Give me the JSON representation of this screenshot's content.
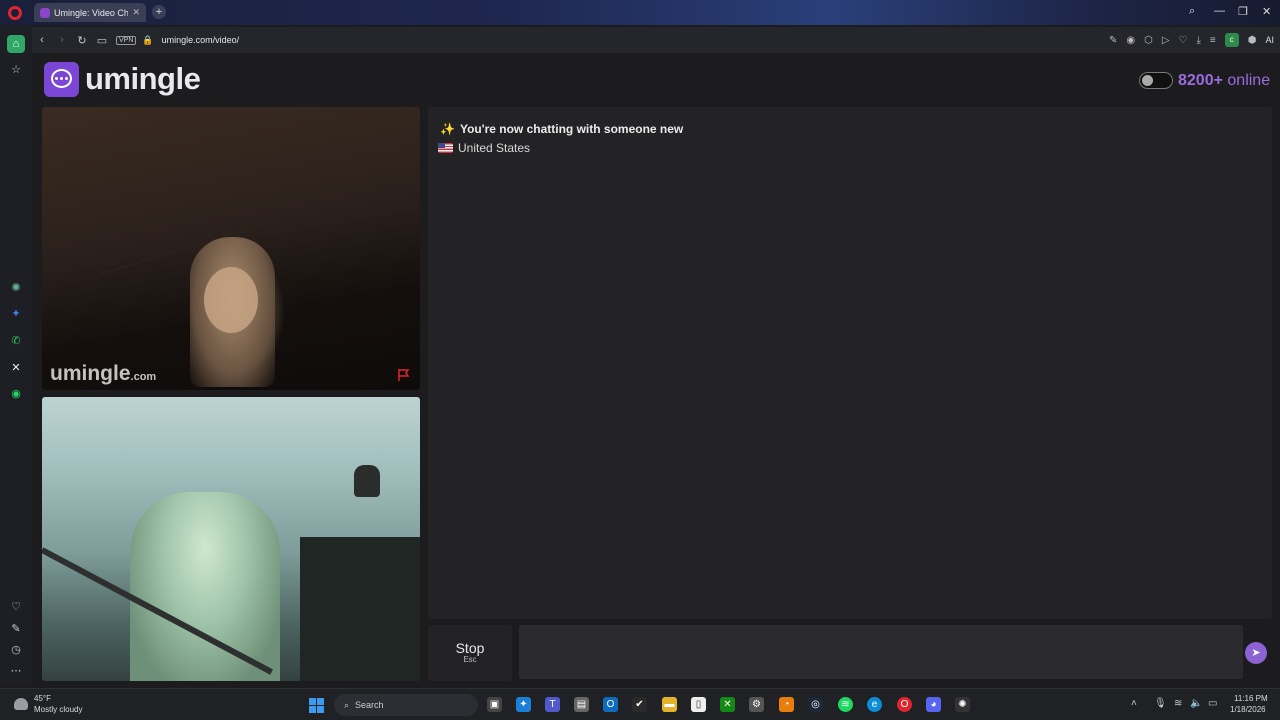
{
  "browser": {
    "tab_title": "Umingle: Video Chat",
    "url": "umingle.com/video/",
    "vpn_badge": "VPN",
    "profile_letter": "c",
    "ai_label": "AI"
  },
  "site": {
    "brand_name": "umingle",
    "online_count": "8200+",
    "online_label": "online"
  },
  "video": {
    "watermark_main": "umingle",
    "watermark_suffix": ".com"
  },
  "chat": {
    "message": "You're now chatting with someone new",
    "country": "United States"
  },
  "controls": {
    "stop_label": "Stop",
    "stop_hint": "Esc",
    "message_placeholder": ""
  },
  "taskbar": {
    "temperature": "45°F",
    "condition": "Mostly cloudy",
    "search_label": "Search",
    "time": "11:16 PM",
    "date": "1/18/2026"
  },
  "colors": {
    "accent": "#7b45d6",
    "online_text": "#9b6be0",
    "report_flag": "#e0252f"
  }
}
